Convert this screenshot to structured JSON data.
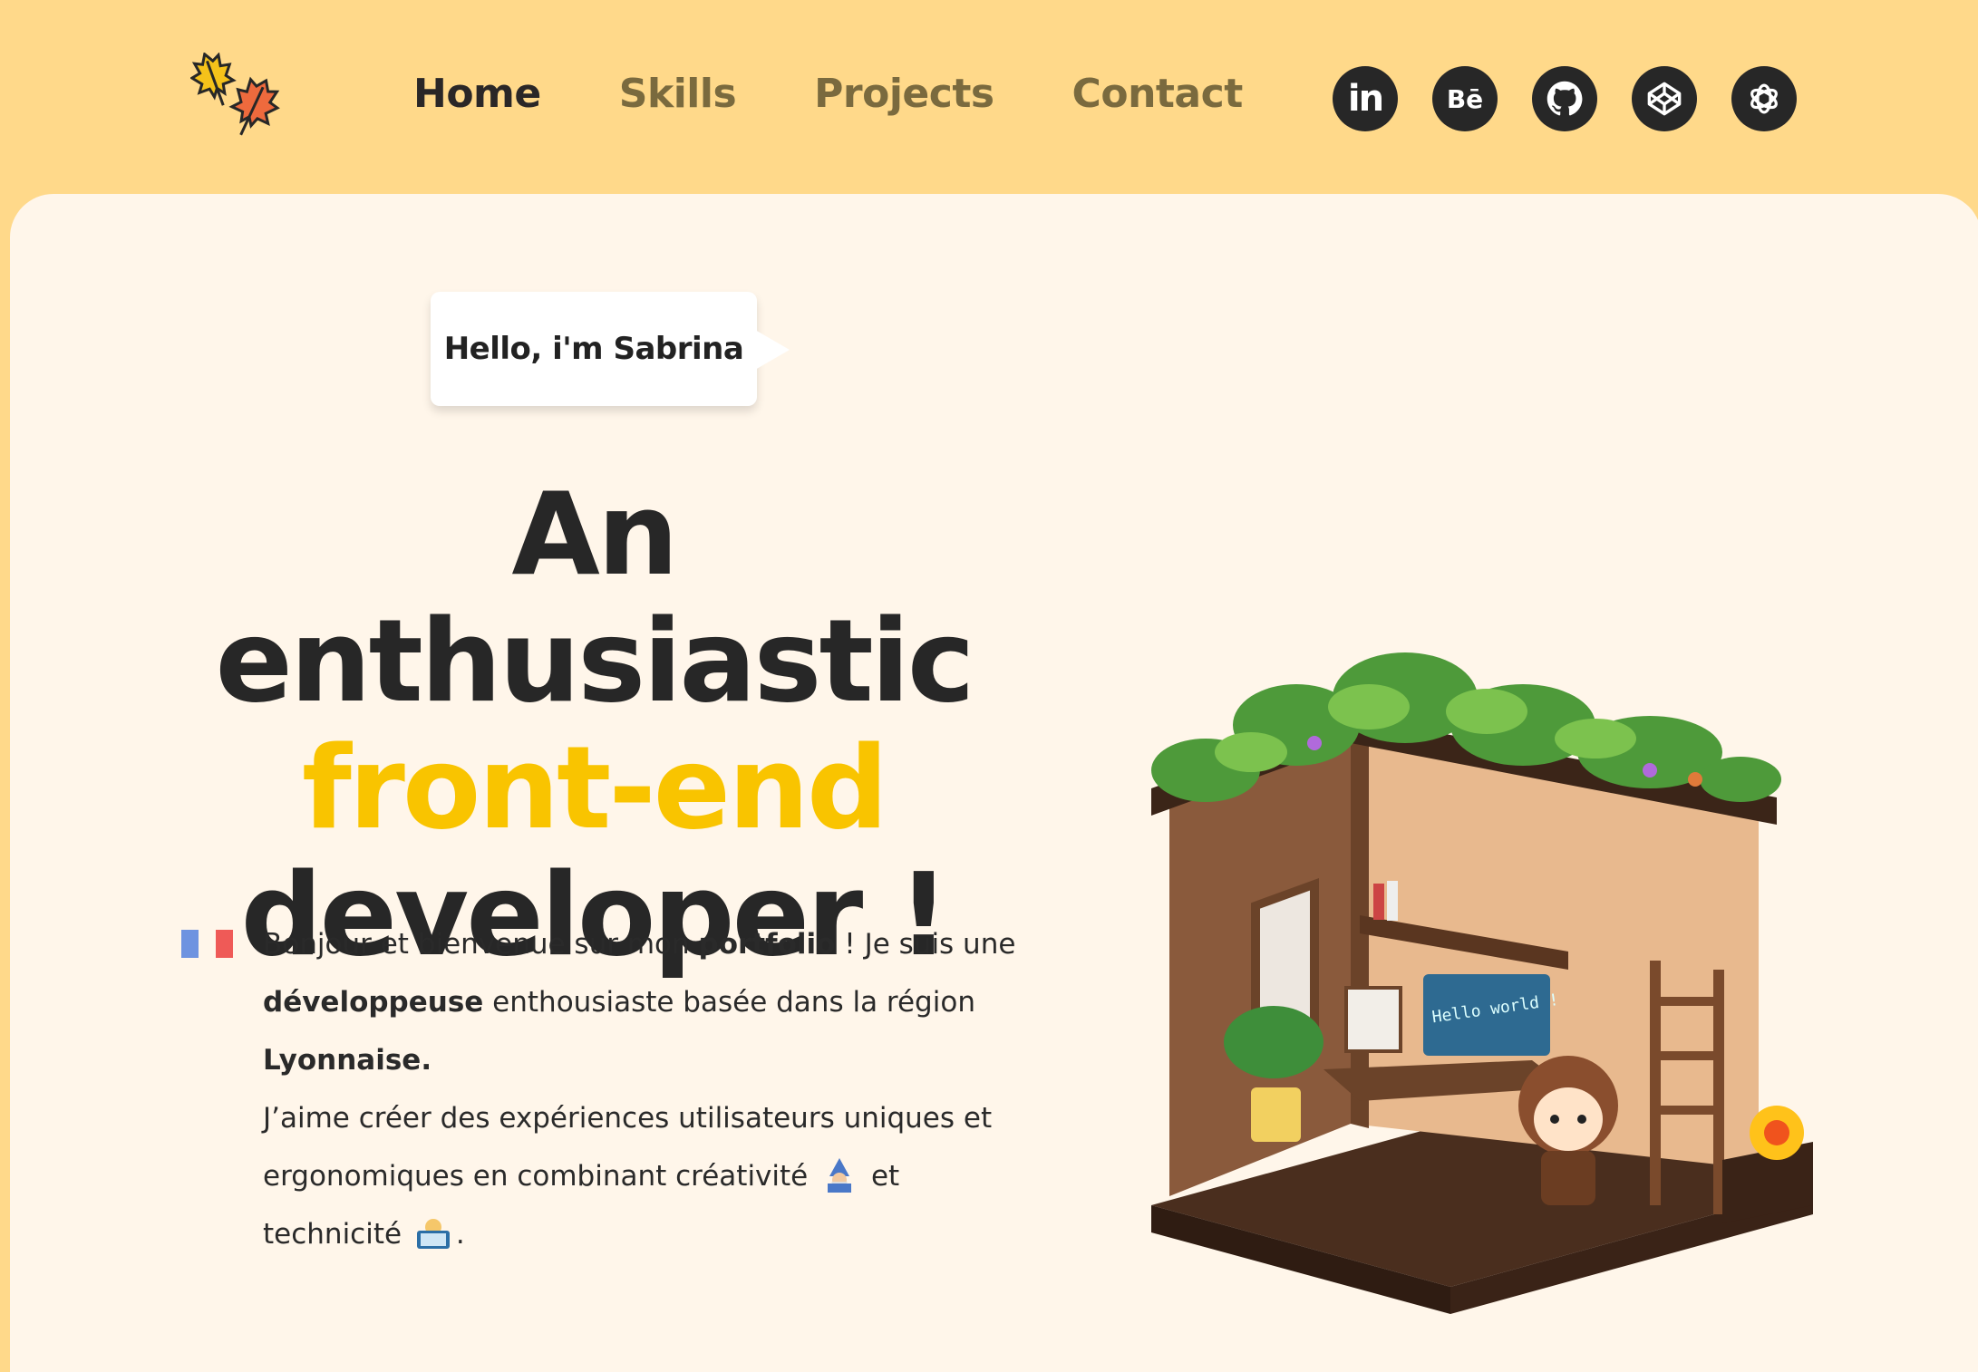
{
  "nav": {
    "items": [
      {
        "label": "Home",
        "active": true
      },
      {
        "label": "Skills",
        "active": false
      },
      {
        "label": "Projects",
        "active": false
      },
      {
        "label": "Contact",
        "active": false
      }
    ]
  },
  "socials": [
    {
      "label": "in",
      "icon": "linkedin-icon"
    },
    {
      "label": "Bē",
      "icon": "behance-icon"
    },
    {
      "label": "",
      "icon": "github-icon"
    },
    {
      "label": "",
      "icon": "codepen-icon"
    },
    {
      "label": "",
      "icon": "openai-icon"
    }
  ],
  "hero": {
    "greeting": "Hello, i'm Sabrina",
    "line1": "An enthusiastic",
    "line2": "front-end",
    "line3": "developer !"
  },
  "intro": {
    "p1": "Bonjour et bienvenue sur mon ",
    "b1": "portfolio",
    "p2": " ! Je suis une ",
    "b2": "développeuse",
    "p3": " enthousiaste basée dans la région ",
    "b3": "Lyonnaise.",
    "p4": "J’aime créer des expériences utilisateurs uniques et ergonomiques en combinant créativité ",
    "p5": " et technicité ",
    "p6": "."
  },
  "illustration": {
    "screen_text": "Hello world !"
  },
  "colors": {
    "header_bg": "#FFD98A",
    "card_bg": "#FFF6EA",
    "accent": "#F9C400",
    "dark": "#272727"
  }
}
